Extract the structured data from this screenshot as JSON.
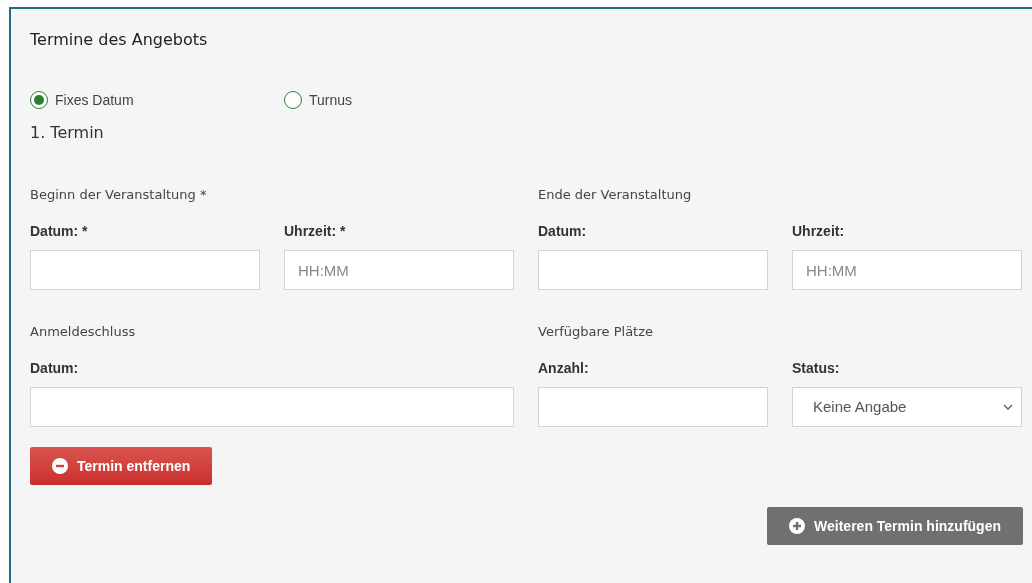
{
  "title": "Termine des Angebots",
  "date_mode": [
    {
      "label": "Fixes Datum",
      "selected": true
    },
    {
      "label": "Turnus",
      "selected": false
    }
  ],
  "appointment": {
    "heading": "1. Termin",
    "groups": [
      {
        "label": "Beginn der Veranstaltung *",
        "fields": [
          {
            "kind": "text",
            "label": "Datum: *"
          },
          {
            "kind": "text",
            "label": "Uhrzeit: *",
            "placeholder": "HH:MM"
          }
        ]
      },
      {
        "label": "Ende der Veranstaltung",
        "fields": [
          {
            "kind": "text",
            "label": "Datum:"
          },
          {
            "kind": "text",
            "label": "Uhrzeit:",
            "placeholder": "HH:MM"
          }
        ]
      },
      {
        "label": "Anmeldeschluss",
        "fields": [
          {
            "kind": "wide",
            "label": "Datum:"
          }
        ]
      },
      {
        "label": "Verfügbare Plätze",
        "fields": [
          {
            "kind": "text",
            "label": "Anzahl:"
          },
          {
            "kind": "select",
            "label": "Status:",
            "value": "Keine Angabe"
          }
        ]
      }
    ],
    "remove_button": "Termin entfernen"
  },
  "add_button": "Weiteren Termin hinzufügen"
}
